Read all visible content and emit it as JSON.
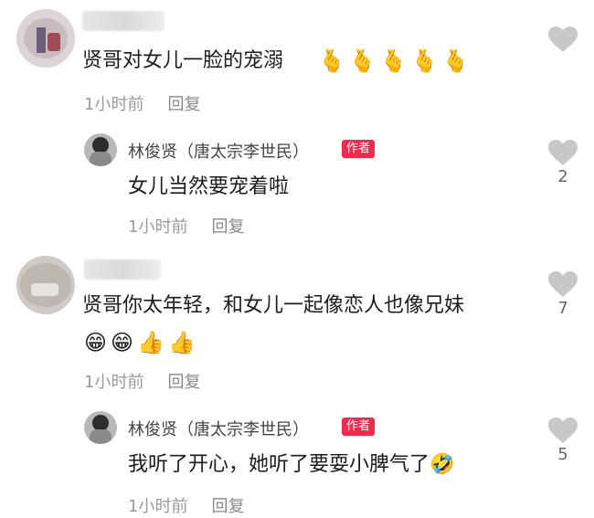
{
  "comments": [
    {
      "text": "贤哥对女儿一脸的宠溺",
      "emojis": [
        "🫰",
        "🫰",
        "🫰",
        "🫰",
        "🫰"
      ],
      "time": "1小时前",
      "reply_label": "回复",
      "likes": "",
      "reply": {
        "author": "林俊贤（唐太宗李世民）",
        "badge": "作者",
        "text": "女儿当然要宠着啦",
        "time": "1小时前",
        "reply_label": "回复",
        "likes": "2"
      }
    },
    {
      "text": "贤哥你太年轻，和女儿一起像恋人也像兄妹",
      "emojis": [
        "😁",
        "😁",
        "👍",
        "👍"
      ],
      "time": "1小时前",
      "reply_label": "回复",
      "likes": "7",
      "reply": {
        "author": "林俊贤（唐太宗李世民）",
        "badge": "作者",
        "text": "我听了开心，她听了要耍小脾气了",
        "trailing_emoji": "🤣",
        "time": "1小时前",
        "reply_label": "回复",
        "likes": "5"
      }
    }
  ],
  "colors": {
    "badge": "#ee2a4e",
    "heart": "#c8c8c8",
    "meta": "#9b9b9b"
  }
}
